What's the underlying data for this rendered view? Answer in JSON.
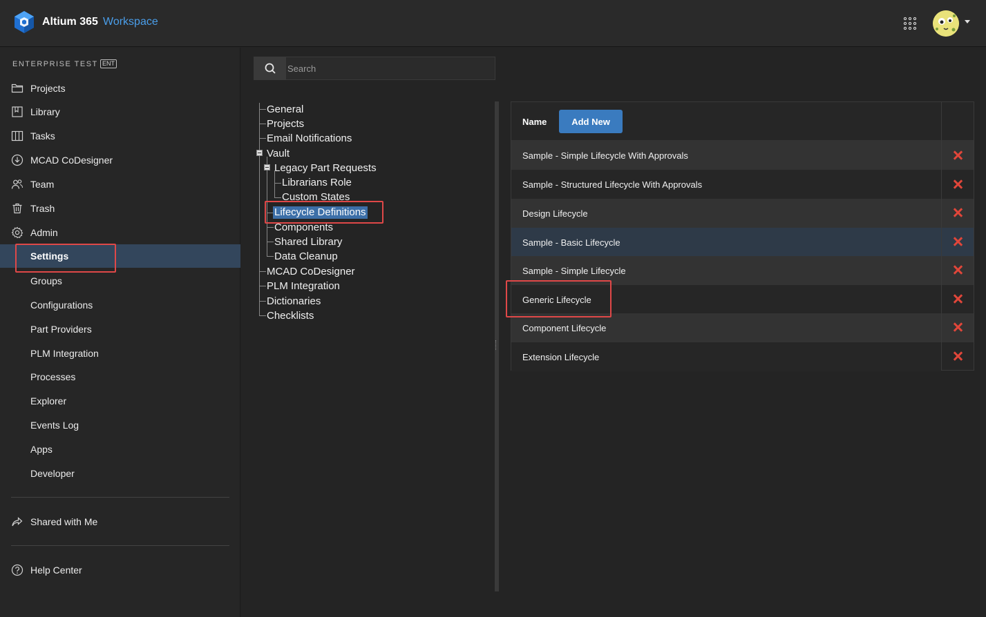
{
  "header": {
    "app_name": "Altium 365",
    "app_sub": "Workspace"
  },
  "sidebar": {
    "org_name": "ENTERPRISE TEST",
    "org_badge": "ENT",
    "items": [
      {
        "label": "Projects",
        "icon": "folder-icon"
      },
      {
        "label": "Library",
        "icon": "library-icon"
      },
      {
        "label": "Tasks",
        "icon": "tasks-icon"
      },
      {
        "label": "MCAD CoDesigner",
        "icon": "download-circle-icon"
      },
      {
        "label": "Team",
        "icon": "team-icon"
      },
      {
        "label": "Trash",
        "icon": "trash-icon"
      },
      {
        "label": "Admin",
        "icon": "gear-icon"
      }
    ],
    "admin_sub": [
      {
        "label": "Settings",
        "active": true
      },
      {
        "label": "Groups"
      },
      {
        "label": "Configurations"
      },
      {
        "label": "Part Providers"
      },
      {
        "label": "PLM Integration"
      },
      {
        "label": "Processes"
      },
      {
        "label": "Explorer"
      },
      {
        "label": "Events Log"
      },
      {
        "label": "Apps"
      },
      {
        "label": "Developer"
      }
    ],
    "shared": {
      "label": "Shared with Me",
      "icon": "share-icon"
    },
    "help": {
      "label": "Help Center",
      "icon": "help-icon"
    }
  },
  "search": {
    "placeholder": "Search"
  },
  "tree": {
    "nodes": [
      {
        "label": "General"
      },
      {
        "label": "Projects"
      },
      {
        "label": "Email Notifications"
      },
      {
        "label": "Vault"
      },
      {
        "label": "Legacy Part Requests"
      },
      {
        "label": "Librarians Role"
      },
      {
        "label": "Custom States"
      },
      {
        "label": "Lifecycle Definitions",
        "selected": true
      },
      {
        "label": "Components"
      },
      {
        "label": "Shared Library"
      },
      {
        "label": "Data Cleanup"
      },
      {
        "label": "MCAD CoDesigner"
      },
      {
        "label": "PLM Integration"
      },
      {
        "label": "Dictionaries"
      },
      {
        "label": "Checklists"
      }
    ]
  },
  "table": {
    "header_name": "Name",
    "add_label": "Add New",
    "rows": [
      {
        "name": "Sample - Simple Lifecycle With Approvals"
      },
      {
        "name": "Sample - Structured Lifecycle With Approvals"
      },
      {
        "name": "Design Lifecycle"
      },
      {
        "name": "Sample - Basic Lifecycle"
      },
      {
        "name": "Sample - Simple Lifecycle"
      },
      {
        "name": "Generic Lifecycle"
      },
      {
        "name": "Component Lifecycle"
      },
      {
        "name": "Extension Lifecycle"
      }
    ]
  },
  "colors": {
    "accent": "#3a7bbf",
    "brand_text": "#4a9eea",
    "delete": "#e0463a",
    "highlight": "#e04848"
  }
}
